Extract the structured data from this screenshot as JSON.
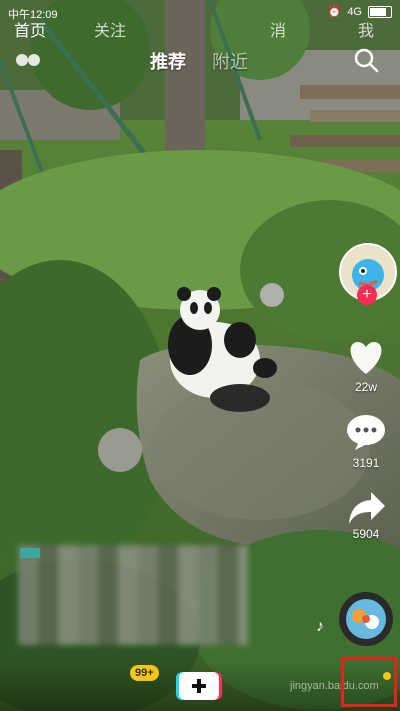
{
  "status_bar": {
    "time": "中午12:09",
    "network": "4G"
  },
  "top_tabs": {
    "recommend": "推荐",
    "nearby": "附近"
  },
  "right_rail": {
    "likes": "22w",
    "comments": "3191",
    "shares": "5904"
  },
  "bottom_nav": {
    "home": "首页",
    "follow": "关注",
    "follow_badge": "99+",
    "message": "消",
    "me": "我"
  },
  "watermark": "jingyan.baidu.com",
  "colors": {
    "accent_red": "#fe2c55",
    "highlight_red": "#e8211f",
    "badge_yellow": "#f5c518"
  }
}
